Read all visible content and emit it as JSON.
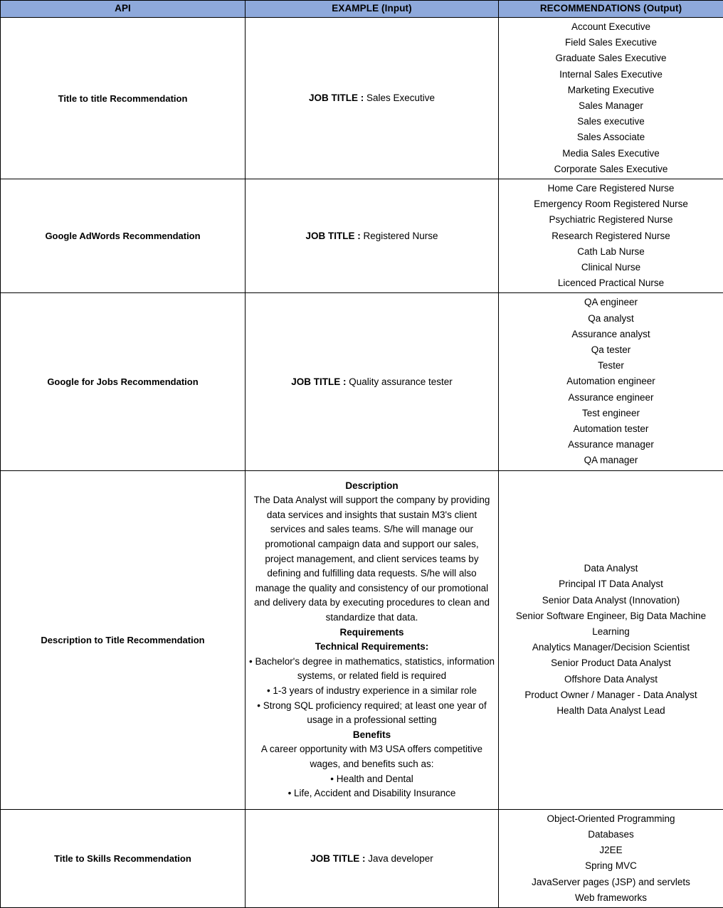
{
  "table": {
    "headers": [
      "API",
      "EXAMPLE (Input)",
      "RECOMMENDATIONS (Output)"
    ],
    "header_bg_color": "#8EA9DB",
    "border_color": "#000000",
    "rows": [
      {
        "api": "Title to title Recommendation",
        "example_label": "JOB TITLE :",
        "example_value": "Sales Executive",
        "recommendations": [
          "Account Executive",
          "Field Sales Executive",
          "Graduate Sales Executive",
          "Internal Sales Executive",
          "Marketing Executive",
          "Sales Manager",
          "Sales executive",
          "Sales Associate",
          "Media Sales Executive",
          "Corporate Sales Executive"
        ]
      },
      {
        "api": "Google AdWords Recommendation",
        "example_label": "JOB TITLE :",
        "example_value": "Registered Nurse",
        "recommendations": [
          "Home Care Registered Nurse",
          "Emergency Room Registered Nurse",
          "Psychiatric Registered Nurse",
          "Research Registered Nurse",
          "Cath Lab Nurse",
          "Clinical Nurse",
          "Licenced Practical Nurse"
        ]
      },
      {
        "api": "Google for Jobs Recommendation",
        "example_label": "JOB TITLE :",
        "example_value": "Quality assurance tester",
        "recommendations": [
          "QA engineer",
          "Qa analyst",
          "Assurance analyst",
          "Qa tester",
          "Tester",
          "Automation engineer",
          "Assurance engineer",
          "Test engineer",
          "Automation tester",
          "Assurance manager",
          "QA manager"
        ]
      },
      {
        "api": "Description to Title Recommendation",
        "description": {
          "heading_description": "Description",
          "paragraph": "The Data Analyst will support the company by providing data services and insights that sustain M3's client services and sales teams. S/he will manage our promotional campaign data and support our sales, project management, and client services teams by defining and fulfilling data requests. S/he will also manage the quality and consistency of our promotional and delivery data by executing procedures to clean and standardize that data.",
          "heading_requirements": "Requirements",
          "heading_technical": "Technical Requirements:",
          "technical_bullets": [
            "• Bachelor's degree in mathematics, statistics, information systems, or related field is required",
            "• 1-3 years of industry experience in a similar role",
            "• Strong SQL proficiency required; at least one year of usage in a professional setting"
          ],
          "heading_benefits": "Benefits",
          "benefits_intro": "A career opportunity with M3 USA offers competitive wages, and benefits such as:",
          "benefits_bullets": [
            "• Health and Dental",
            "• Life, Accident and Disability Insurance"
          ]
        },
        "recommendations": [
          "Data Analyst",
          "Principal IT Data Analyst",
          "Senior Data Analyst (Innovation)",
          "Senior Software Engineer, Big Data Machine Learning",
          "Analytics Manager/Decision Scientist",
          "Senior Product Data Analyst",
          "Offshore Data Analyst",
          "Product Owner / Manager - Data Analyst",
          "Health Data Analyst Lead"
        ]
      },
      {
        "api": "Title to Skills Recommendation",
        "example_label": "JOB TITLE :",
        "example_value": "Java developer",
        "recommendations": [
          "Object-Oriented Programming",
          "Databases",
          "J2EE",
          "Spring MVC",
          "JavaServer pages (JSP) and servlets",
          "Web frameworks"
        ]
      }
    ]
  }
}
